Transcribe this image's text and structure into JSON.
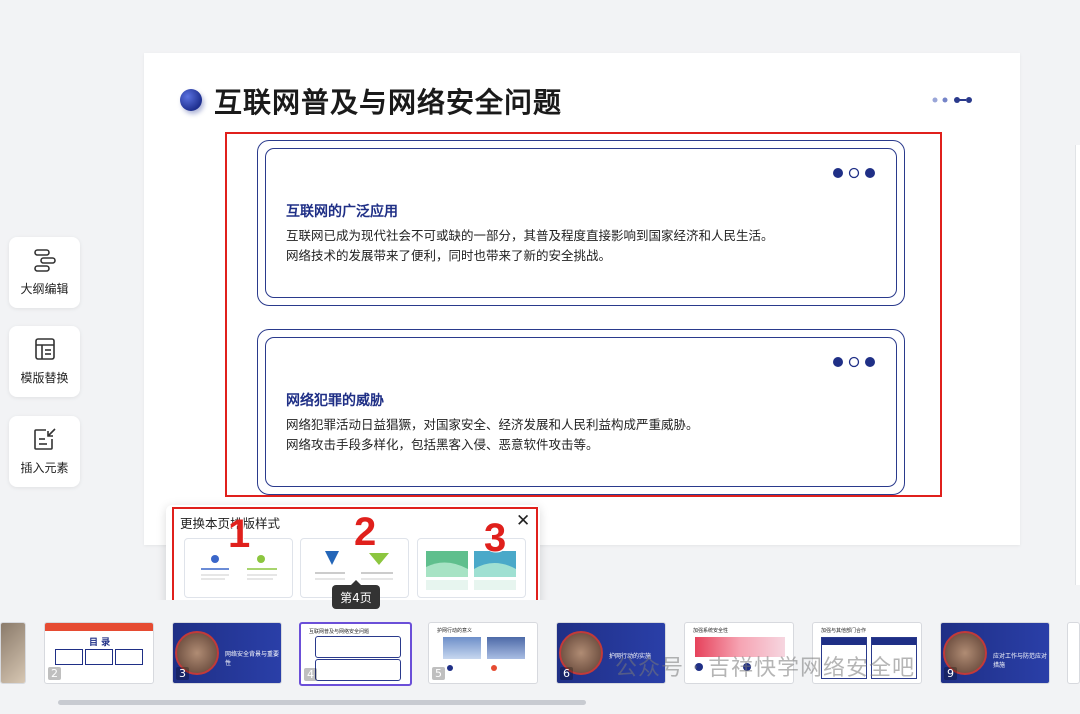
{
  "tools": [
    {
      "label": "大纲编辑",
      "icon": "outline-icon"
    },
    {
      "label": "模版替换",
      "icon": "template-icon"
    },
    {
      "label": "插入元素",
      "icon": "insert-element-icon"
    }
  ],
  "slide": {
    "title": "互联网普及与网络安全问题",
    "cards": [
      {
        "title": "互联网的广泛应用",
        "lines": [
          "互联网已成为现代社会不可或缺的一部分，其普及程度直接影响到国家经济和人民生活。",
          "网络技术的发展带来了便利，同时也带来了新的安全挑战。"
        ]
      },
      {
        "title": "网络犯罪的威胁",
        "lines": [
          "网络犯罪活动日益猖獗，对国家安全、经济发展和人民利益构成严重威胁。",
          "网络攻击手段多样化，包括黑客入侵、恶意软件攻击等。"
        ]
      }
    ]
  },
  "layout_popup": {
    "title": "更换本页排版样式",
    "close": "✕",
    "markers": [
      "1",
      "2",
      "3"
    ]
  },
  "tooltip": "第4页",
  "thumbnails": [
    {
      "num": "2",
      "text": "目 录"
    },
    {
      "num": "3",
      "text": "网络安全背景与重要性"
    },
    {
      "num": "4",
      "text": "互联网普及与网络安全问题"
    },
    {
      "num": "5",
      "text": "护网行动的意义"
    },
    {
      "num": "6",
      "text": "护网行动的实施"
    },
    {
      "num": "7",
      "text": "加强系统安全性"
    },
    {
      "num": "8",
      "text": "加强与其他部门合作"
    },
    {
      "num": "9",
      "text": "应对工作与防范应对措施"
    }
  ],
  "watermark": "公众号 · 吉祥快学网络安全吧",
  "colors": {
    "accent": "#1f2f86",
    "highlight": "#e0201c",
    "active_thumb": "#6b4fd8"
  }
}
